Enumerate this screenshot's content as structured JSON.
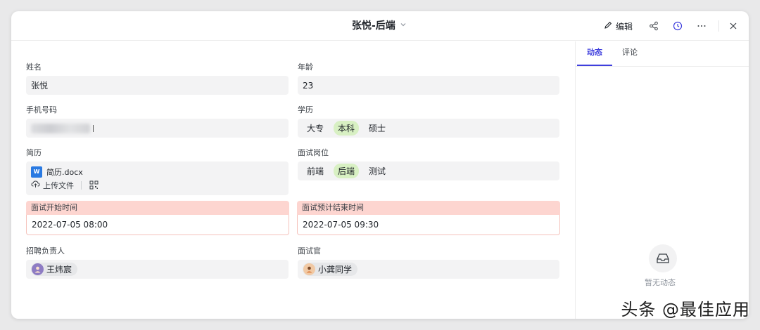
{
  "header": {
    "title": "张悦-后端",
    "edit_label": "编辑"
  },
  "fields": {
    "name": {
      "label": "姓名",
      "value": "张悦"
    },
    "age": {
      "label": "年龄",
      "value": "23"
    },
    "phone": {
      "label": "手机号码"
    },
    "education": {
      "label": "学历",
      "options": [
        "大专",
        "本科",
        "硕士"
      ],
      "selected": "本科"
    },
    "resume": {
      "label": "简历",
      "file_name": "简历.docx",
      "upload_label": "上传文件"
    },
    "position": {
      "label": "面试岗位",
      "options": [
        "前端",
        "后端",
        "测试"
      ],
      "selected": "后端"
    },
    "start_time": {
      "label": "面试开始时间",
      "value": "2022-07-05 08:00"
    },
    "end_time": {
      "label": "面试预计结束时间",
      "value": "2022-07-05 09:30"
    },
    "recruiter": {
      "label": "招聘负责人",
      "person": "王炜宸"
    },
    "interviewer": {
      "label": "面试官",
      "person": "小龚同学"
    }
  },
  "sidebar": {
    "tabs": [
      "动态",
      "评论"
    ],
    "active_tab": "动态",
    "empty_text": "暂无动态"
  },
  "watermark": "头条 @最佳应用",
  "colors": {
    "accent": "#3f3fdd",
    "selected_tag": "#d8f0c3",
    "warning_header": "#fdd5d0"
  }
}
